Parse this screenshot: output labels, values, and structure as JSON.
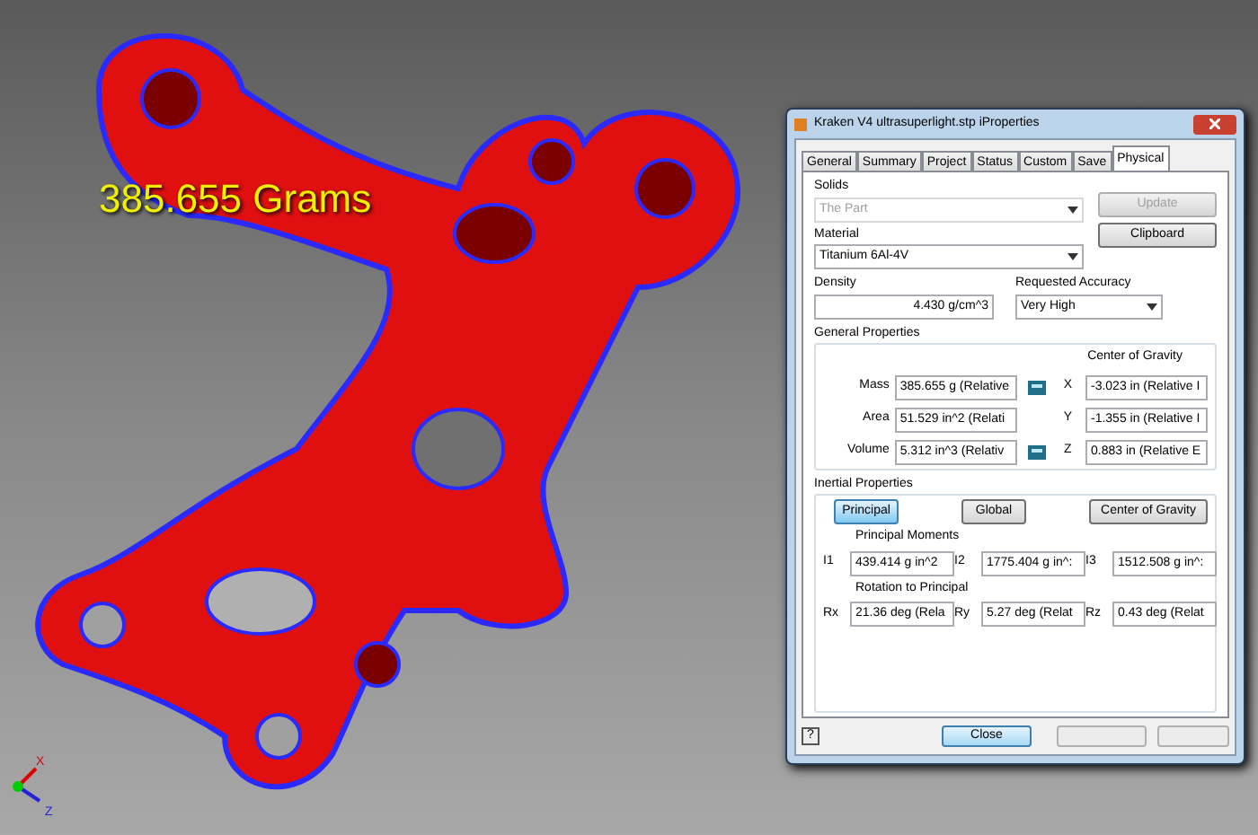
{
  "viewport": {
    "mass_label": "385.655 Grams",
    "triad": {
      "x_label": "X",
      "z_label": "Z"
    }
  },
  "dialog": {
    "title": "Kraken V4 ultrasuperlight.stp iProperties",
    "tabs": [
      {
        "label": "General",
        "selected": false
      },
      {
        "label": "Summary",
        "selected": false
      },
      {
        "label": "Project",
        "selected": false
      },
      {
        "label": "Status",
        "selected": false
      },
      {
        "label": "Custom",
        "selected": false
      },
      {
        "label": "Save",
        "selected": false
      },
      {
        "label": "Physical",
        "selected": true
      }
    ],
    "solids": {
      "label": "Solids",
      "value": "The Part",
      "disabled": true
    },
    "update_button": {
      "label": "Update",
      "disabled": true
    },
    "clipboard_button": {
      "label": "Clipboard",
      "disabled": false
    },
    "material": {
      "label": "Material",
      "value": "Titanium 6Al-4V"
    },
    "density": {
      "label": "Density",
      "value": "4.430 g/cm^3"
    },
    "accuracy": {
      "label": "Requested Accuracy",
      "value": "Very High"
    },
    "general": {
      "title": "General Properties",
      "cog_title": "Center of Gravity",
      "rows": [
        {
          "label": "Mass",
          "value": "385.655 g (Relative",
          "calc_icon": true,
          "axis": "X",
          "cog": "-3.023 in (Relative I"
        },
        {
          "label": "Area",
          "value": "51.529 in^2 (Relati",
          "calc_icon": false,
          "axis": "Y",
          "cog": "-1.355 in (Relative I"
        },
        {
          "label": "Volume",
          "value": "5.312 in^3 (Relativ",
          "calc_icon": true,
          "axis": "Z",
          "cog": "0.883 in (Relative E"
        }
      ]
    },
    "inertial": {
      "title": "Inertial Properties",
      "buttons": [
        {
          "label": "Principal",
          "selected": true
        },
        {
          "label": "Global",
          "selected": false
        },
        {
          "label": "Center of Gravity",
          "selected": false
        }
      ],
      "moments_title": "Principal Moments",
      "moments": [
        {
          "label": "I1",
          "value": "439.414 g in^2"
        },
        {
          "label": "I2",
          "value": "1775.404 g in^:"
        },
        {
          "label": "I3",
          "value": "1512.508 g in^:"
        }
      ],
      "rotation_title": "Rotation to Principal",
      "rotations": [
        {
          "label": "Rx",
          "value": "21.36 deg (Rela"
        },
        {
          "label": "Ry",
          "value": "5.27 deg (Relat"
        },
        {
          "label": "Rz",
          "value": "0.43 deg (Relat"
        }
      ]
    },
    "footer": {
      "help_label": "?",
      "close_label": "Close"
    }
  }
}
